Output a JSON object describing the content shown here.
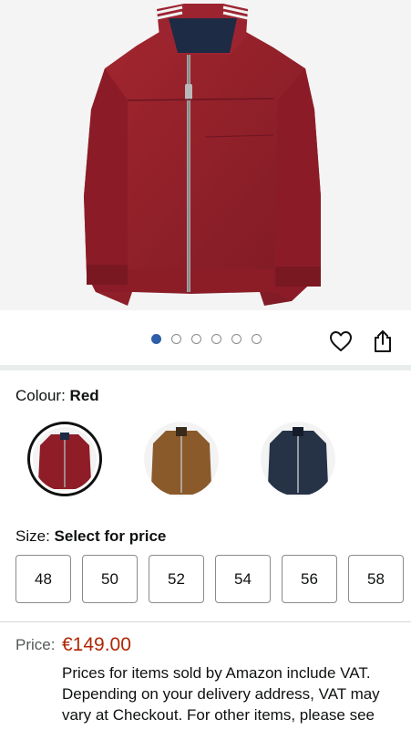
{
  "gallery": {
    "image_name": "red-jacket-product-image",
    "image_count": 6,
    "active_index": 0
  },
  "colour": {
    "label": "Colour:",
    "selected_value": "Red",
    "options": [
      {
        "name": "Red",
        "color": "#8e1d27"
      },
      {
        "name": "Brown",
        "color": "#8a5a2b"
      },
      {
        "name": "Navy",
        "color": "#263347"
      }
    ]
  },
  "size": {
    "label": "Size:",
    "prompt": "Select for price",
    "options": [
      "48",
      "50",
      "52",
      "54",
      "56",
      "58"
    ]
  },
  "price": {
    "label": "Price:",
    "value": "€149.00",
    "vat_note": "Prices for items sold by Amazon include VAT. Depending on your delivery address, VAT may vary at Checkout. For other items, please see details."
  },
  "colors": {
    "price": "#b12704",
    "active_dot": "#2e5fa8"
  },
  "icons": {
    "wishlist": "heart-icon",
    "share": "share-icon"
  }
}
